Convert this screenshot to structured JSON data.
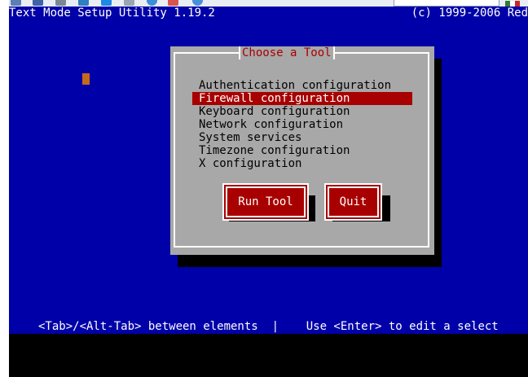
{
  "host": {
    "toolbar_icons": [
      "monitor-icon",
      "save-icon",
      "settings-icon",
      "refresh-icon",
      "windows-icon",
      "window-icon",
      "globe-icon",
      "close-icon"
    ],
    "colors": {
      "flag": [
        "#2e7d32",
        "#ffffff",
        "#c62828"
      ]
    }
  },
  "terminal": {
    "title": "Text Mode Setup Utility 1.19.2",
    "copyright": "(c) 1999-2006 Red",
    "hint": "<Tab>/<Alt-Tab> between elements  |    Use <Enter> to edit a select",
    "colors": {
      "background": "#0000a8",
      "dialog": "#a8a8a8",
      "accent": "#a80000",
      "cursor": "#c46a1b"
    }
  },
  "dialog": {
    "title": "Choose a Tool",
    "items": [
      {
        "label": "Authentication configuration",
        "selected": false
      },
      {
        "label": "Firewall configuration",
        "selected": true
      },
      {
        "label": "Keyboard configuration",
        "selected": false
      },
      {
        "label": "Network configuration",
        "selected": false
      },
      {
        "label": "System services",
        "selected": false
      },
      {
        "label": "Timezone configuration",
        "selected": false
      },
      {
        "label": "X configuration",
        "selected": false
      }
    ],
    "buttons": {
      "run": "Run Tool",
      "quit": "Quit"
    }
  }
}
